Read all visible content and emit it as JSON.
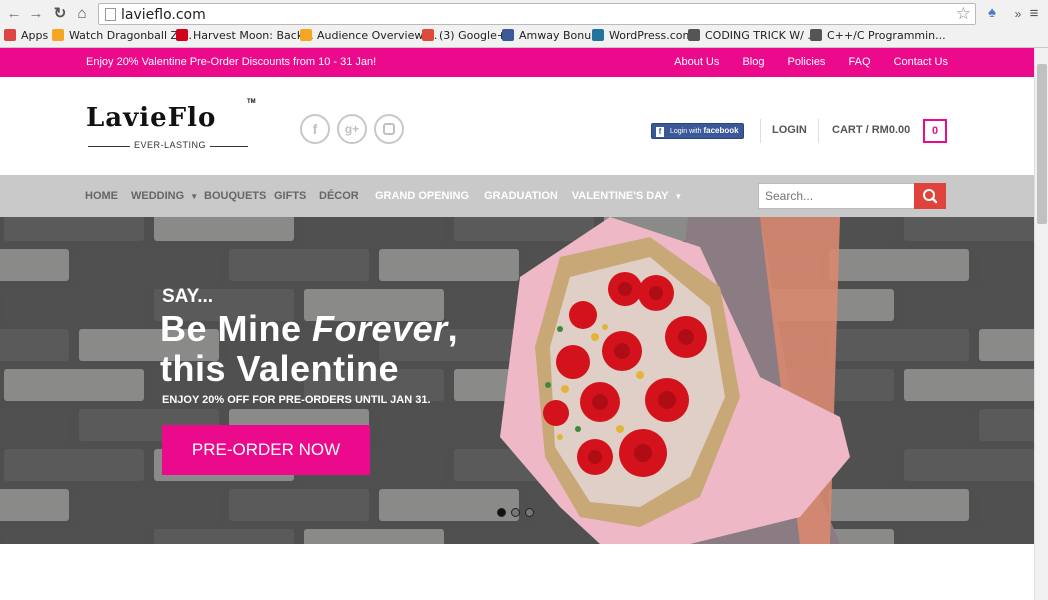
{
  "browser": {
    "url": "lavieflo.com",
    "bookmarks": [
      {
        "label": "Apps",
        "color": "#d44"
      },
      {
        "label": "Watch Dragonball Z ...",
        "color": "#f5a623"
      },
      {
        "label": "Harvest Moon: Back...",
        "color": "#d0021b"
      },
      {
        "label": "Audience Overview ...",
        "color": "#f5a623"
      },
      {
        "label": "(3) Google+",
        "color": "#dd4b39"
      },
      {
        "label": "Amway Bonus",
        "color": "#3b5998"
      },
      {
        "label": "WordPress.com",
        "color": "#21759b"
      },
      {
        "label": "CODING TRICK W/ ...",
        "color": "#555"
      },
      {
        "label": "C++/C Programmin...",
        "color": "#555"
      }
    ]
  },
  "topbar": {
    "promo": "Enjoy 20% Valentine Pre-Order Discounts from 10 - 31 Jan!",
    "links": [
      "About Us",
      "Blog",
      "Policies",
      "FAQ",
      "Contact Us"
    ]
  },
  "logo": {
    "name": "LavieFlo",
    "tagline": "EVER-LASTING",
    "tm": "TM"
  },
  "header": {
    "fb_login_prefix": "Login with",
    "fb_login_brand": "facebook",
    "login": "LOGIN",
    "cart": "CART / RM0.00",
    "cart_count": "0"
  },
  "nav": {
    "items": [
      "HOME",
      "WEDDING",
      "BOUQUETS",
      "GIFTS",
      "DÉCOR"
    ],
    "specials": [
      {
        "label": "GRAND OPENING",
        "color": "#f2a900"
      },
      {
        "label": "GRADUATION",
        "color": "#6a2c91"
      },
      {
        "label": "VALENTINE'S DAY",
        "color": "#e0433c"
      }
    ],
    "search_placeholder": "Search..."
  },
  "hero": {
    "say": "SAY...",
    "line1a": "Be Mine ",
    "line1b": "Forever",
    "line1c": ",",
    "line2": "this Valentine",
    "sub": "ENJOY 20% OFF FOR PRE-ORDERS UNTIL JAN 31.",
    "cta": "PRE-ORDER NOW",
    "slide_count": 3,
    "active_slide": 1
  },
  "colors": {
    "brand_pink": "#ec0a8c",
    "nav_gray": "#c9c9c9"
  }
}
